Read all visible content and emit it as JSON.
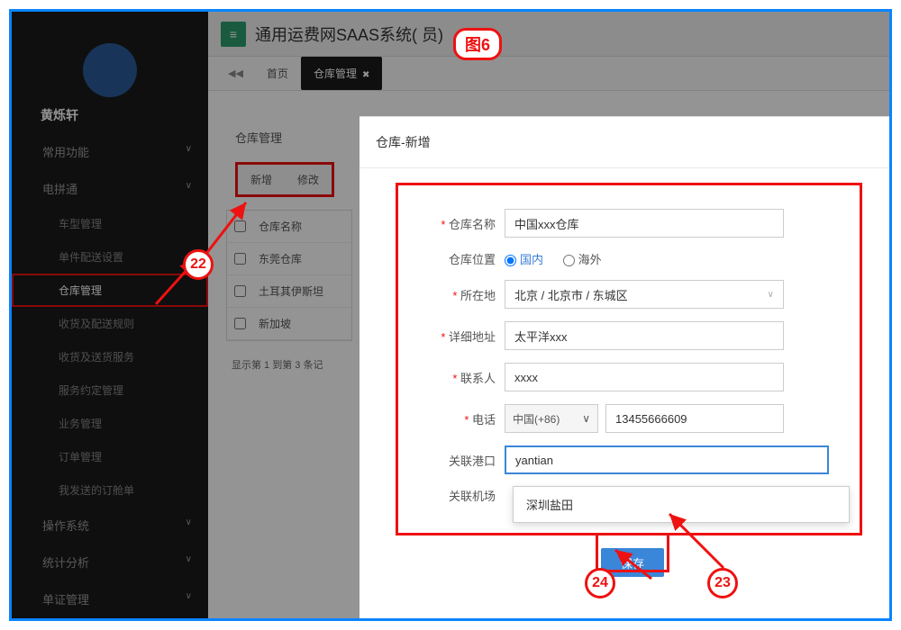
{
  "header": {
    "app_title": "通用运费网SAAS系统(    员)"
  },
  "tabs": {
    "home": "首页",
    "wh": "仓库管理"
  },
  "user": {
    "name": "黄烁轩"
  },
  "sidebar": {
    "groups": {
      "common": "常用功能",
      "eshop": "电拼通",
      "ops": "操作系统",
      "stats": "统计分析",
      "docs": "单证管理"
    },
    "subitems": {
      "vehicle": "车型管理",
      "single": "单件配送设置",
      "wh": "仓库管理",
      "recv_rule": "收货及配送规则",
      "recv_svc": "收货及送货服务",
      "svc_appt": "服务约定管理",
      "biz": "业务管理",
      "order_mgmt": "订单管理",
      "my_sent": "我发送的订舱单"
    }
  },
  "panel": {
    "title": "仓库管理",
    "btn_add": "新增",
    "btn_edit": "修改",
    "col_name": "仓库名称",
    "rows": [
      "东莞仓库",
      "土耳其伊斯坦",
      "新加坡"
    ],
    "pager": "显示第 1 到第 3 条记"
  },
  "modal": {
    "title": "仓库-新增",
    "labels": {
      "name": "仓库名称",
      "loc": "仓库位置",
      "loc_domestic": "国内",
      "loc_overseas": "海外",
      "region": "所在地",
      "address": "详细地址",
      "contact": "联系人",
      "phone": "电话",
      "port": "关联港口",
      "airport": "关联机场"
    },
    "values": {
      "name": "中国xxx仓库",
      "region": "北京 / 北京市 / 东城区",
      "address": "太平洋xxx",
      "contact": "xxxx",
      "phone_cc": "中国(+86)",
      "phone": "13455666609",
      "port": "yantian",
      "port_suggest": "深圳盐田"
    },
    "save": "保存"
  },
  "annotations": {
    "fig": "图6",
    "c22": "22",
    "c23": "23",
    "c24": "24"
  }
}
